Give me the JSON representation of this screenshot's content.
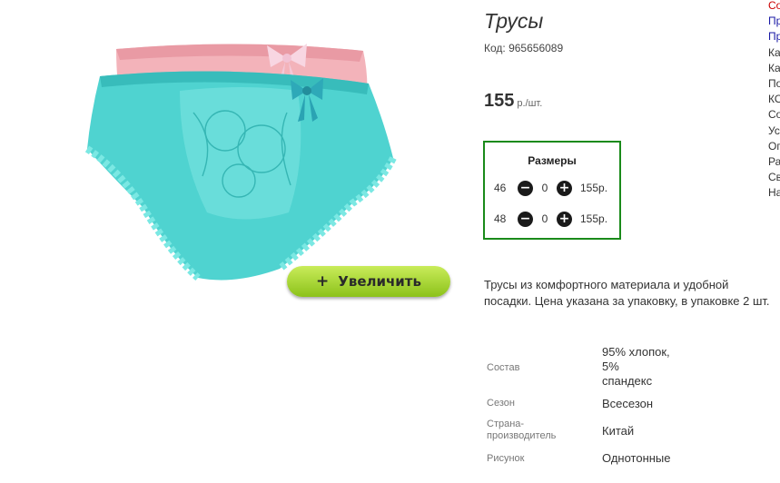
{
  "product": {
    "title": "Трусы",
    "code_label": "Код: 965656089",
    "price": "155",
    "price_unit": "р./шт.",
    "zoom_button": "Увеличить",
    "zoom_icon": "plus-icon",
    "description": "Трусы из комфортного материала и удобной посадки. Цена указана за упаковку, в упаковке 2 шт."
  },
  "sizes": {
    "header": "Размеры",
    "rows": [
      {
        "size": "46",
        "qty": "0",
        "price": "155р."
      },
      {
        "size": "48",
        "qty": "0",
        "price": "155р."
      }
    ]
  },
  "specs": [
    {
      "label": "Состав",
      "value_lines": [
        "95% хлопок,",
        "5%",
        "спандекс"
      ]
    },
    {
      "label": "Сезон",
      "value_lines": [
        "Всесезон"
      ]
    },
    {
      "label": "Страна-производитель",
      "value_lines": [
        "Китай"
      ]
    },
    {
      "label": "Рисунок",
      "value_lines": [
        "Однотонные"
      ]
    }
  ],
  "sidebar_clipped": [
    "Со",
    "Пр",
    "Пр",
    "Ка",
    "Ка",
    "По",
    "КО",
    "Со",
    "Ус",
    "Ог",
    "Ра",
    "Св",
    "На"
  ],
  "colors": {
    "border_green": "#1a8a1a",
    "button_green": "#a6d834",
    "price_red": "#cc0000",
    "link_blue": "#1a1aa6"
  }
}
